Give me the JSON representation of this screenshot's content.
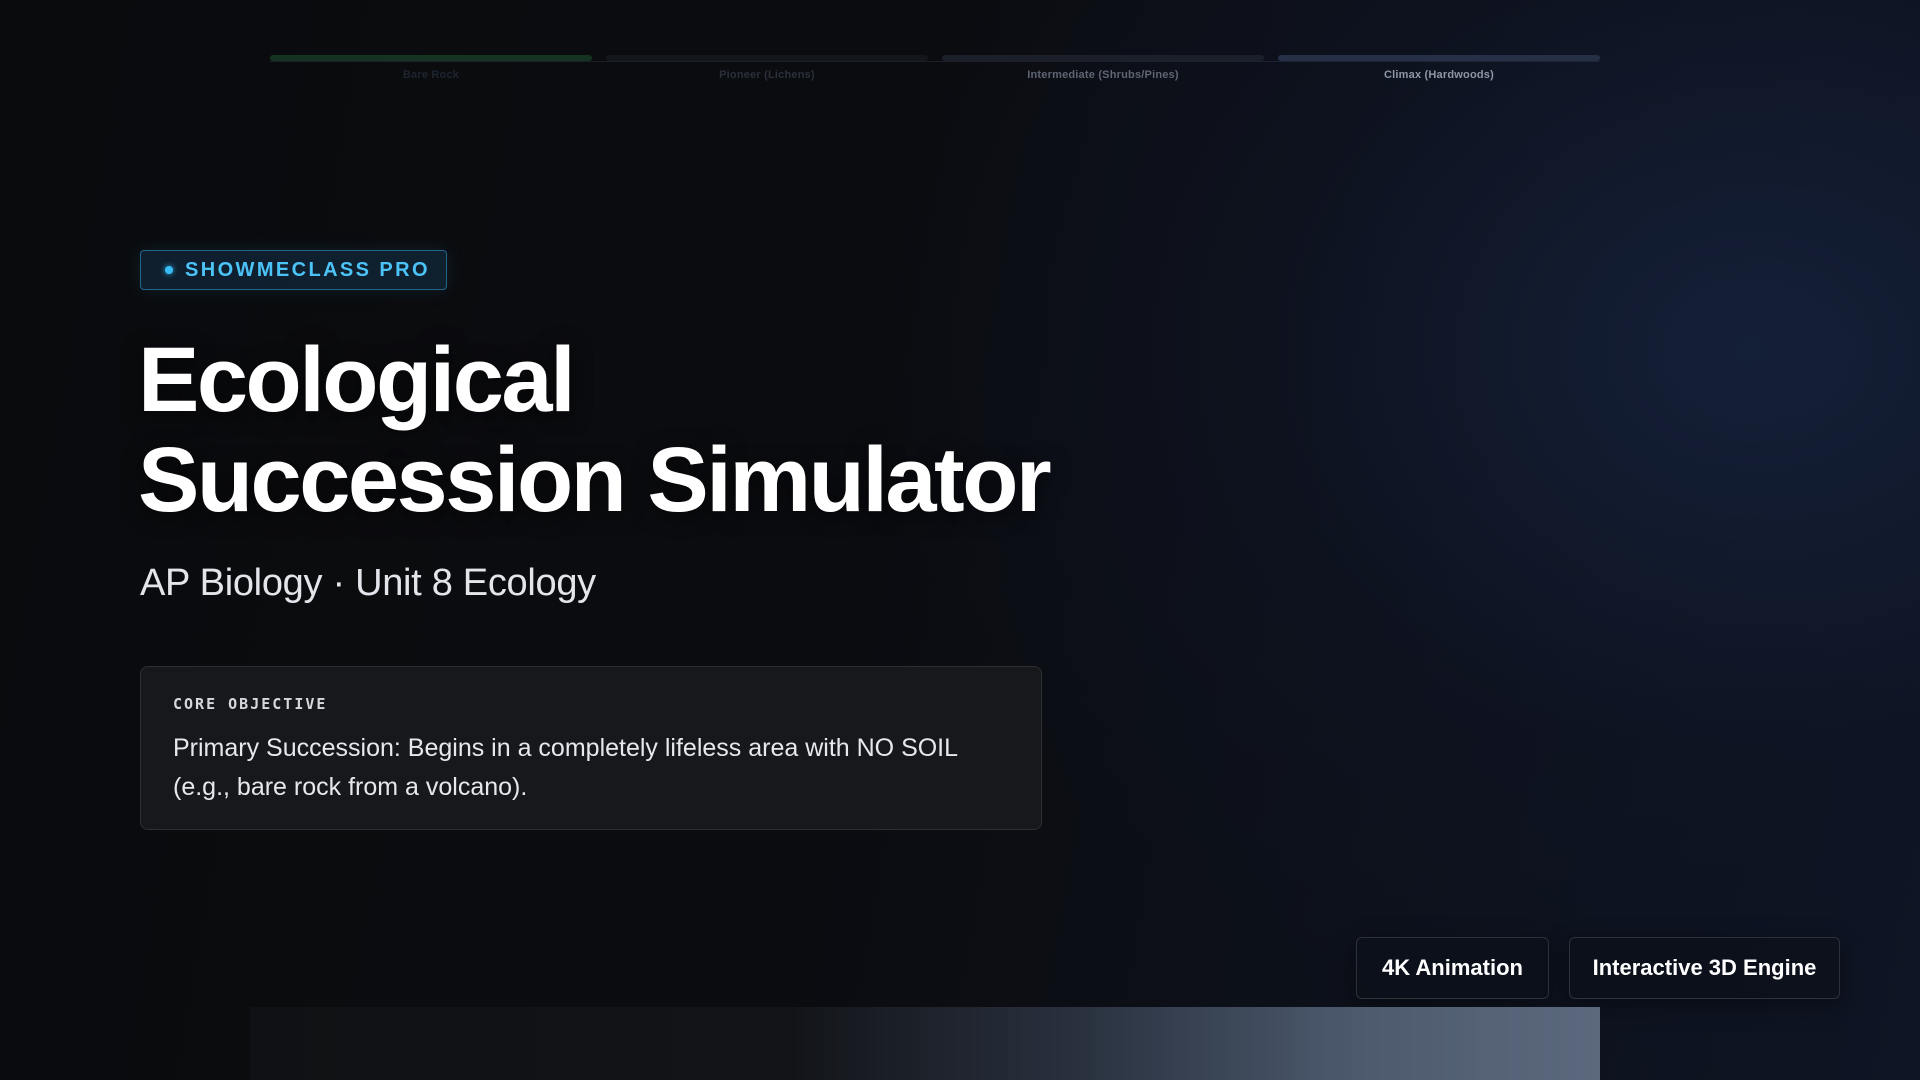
{
  "timeline": {
    "stages": [
      {
        "label": "Bare Rock",
        "bar_color": "#143321",
        "label_color": "#1d2530"
      },
      {
        "label": "Pioneer (Lichens)",
        "bar_color": "#13161c",
        "label_color": "#2a303b"
      },
      {
        "label": "Intermediate (Shrubs/Pines)",
        "bar_color": "#1a1f2a",
        "label_color": "#5e6573"
      },
      {
        "label": "Climax (Hardwoods)",
        "bar_color": "#253047",
        "label_color": "#8f97a6"
      }
    ]
  },
  "badge": {
    "label": "SHOWMECLASS PRO",
    "accent": "#38bdf8"
  },
  "title": {
    "line1": "Ecological",
    "line2": "Succession Simulator"
  },
  "subtitle": "AP Biology · Unit 8 Ecology",
  "objective": {
    "label": "CORE OBJECTIVE",
    "text": "Primary Succession: Begins in a completely lifeless area with NO SOIL (e.g., bare rock from a volcano)."
  },
  "buttons": {
    "animation": "4K Animation",
    "engine": "Interactive 3D Engine"
  }
}
